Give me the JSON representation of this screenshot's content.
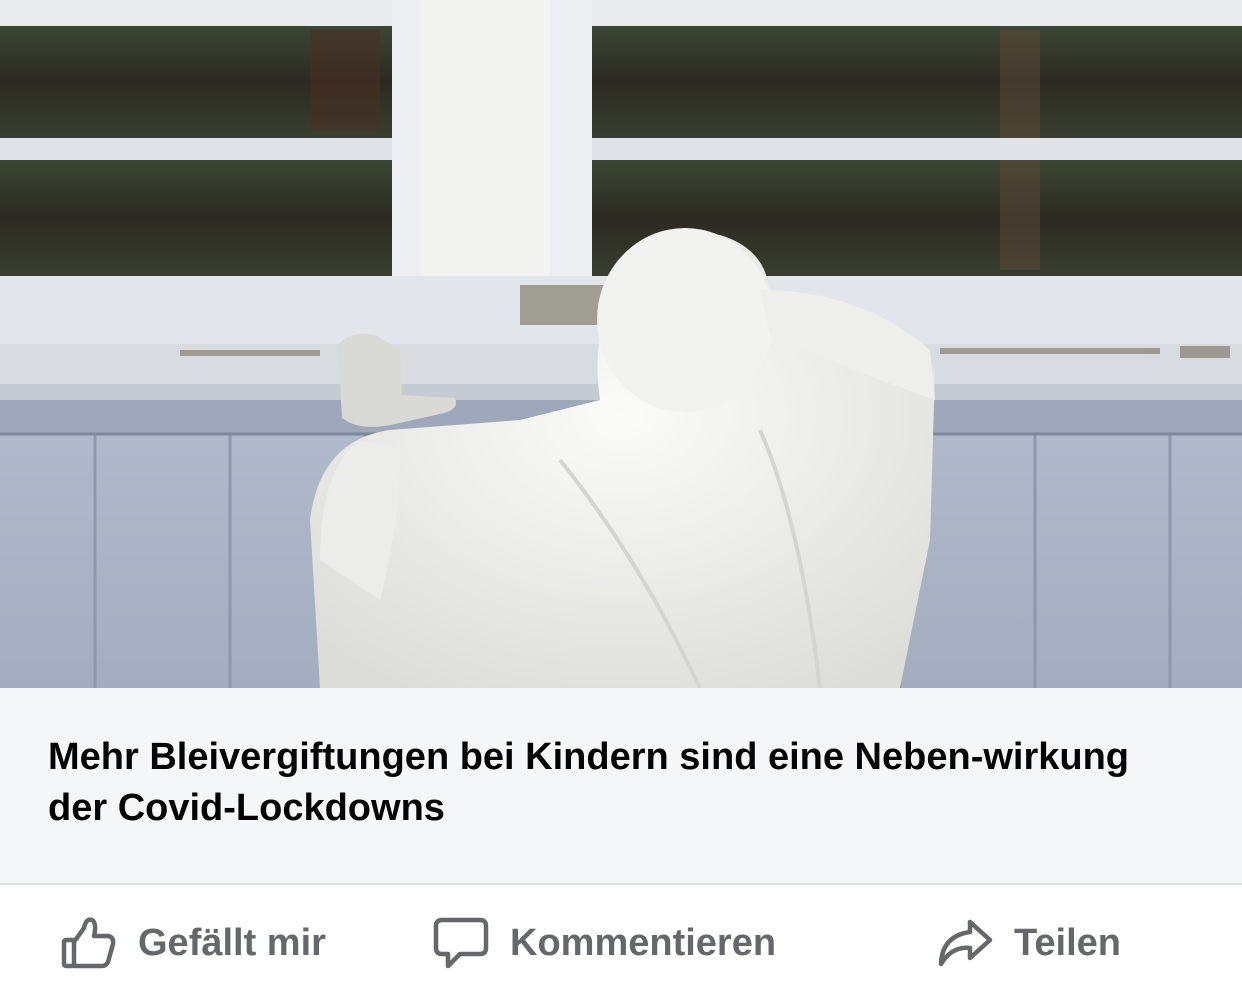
{
  "link_preview": {
    "image_alt": "Person im weißen Schutzanzug blickt durch ein Fenster",
    "title": "Mehr Bleivergiftungen bei Kindern sind eine Neben-wirkung der Covid-Lockdowns"
  },
  "actions": {
    "like": {
      "label": "Gefällt mir",
      "icon": "thumbs-up-icon"
    },
    "comment": {
      "label": "Kommentieren",
      "icon": "comment-bubble-icon"
    },
    "share": {
      "label": "Teilen",
      "icon": "share-arrow-icon"
    }
  },
  "colors": {
    "action_text": "#65676b",
    "caption_background": "#f5f6f8",
    "title_text": "#050505"
  }
}
